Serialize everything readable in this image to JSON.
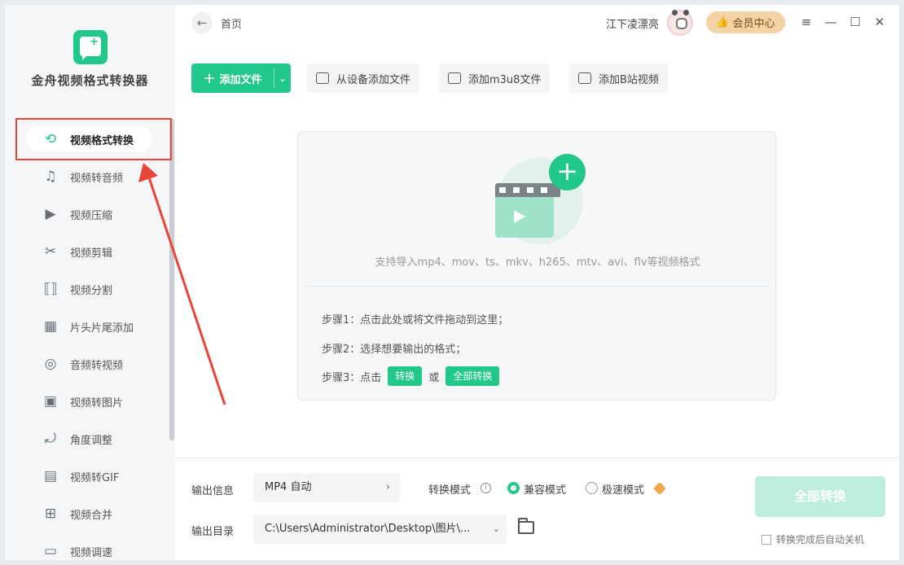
{
  "app": {
    "title": "金舟视频格式转换器"
  },
  "sidebar": {
    "items": [
      {
        "label": "视频格式转换",
        "icon": "convert-icon",
        "active": true
      },
      {
        "label": "视频转音频",
        "icon": "music-note-icon"
      },
      {
        "label": "视频压缩",
        "icon": "compress-icon"
      },
      {
        "label": "视频剪辑",
        "icon": "scissors-icon"
      },
      {
        "label": "视频分割",
        "icon": "split-icon"
      },
      {
        "label": "片头片尾添加",
        "icon": "film-icon"
      },
      {
        "label": "音频转视频",
        "icon": "disc-icon"
      },
      {
        "label": "视频转图片",
        "icon": "image-icon"
      },
      {
        "label": "角度调整",
        "icon": "rotate-icon"
      },
      {
        "label": "视频转GIF",
        "icon": "gif-icon"
      },
      {
        "label": "视频合并",
        "icon": "merge-icon"
      },
      {
        "label": "视频调速",
        "icon": "speed-icon"
      }
    ]
  },
  "header": {
    "breadcrumb": "首页",
    "username": "江下凌漂亮",
    "vip_label": "会员中心"
  },
  "toolbar": {
    "add_file": "添加文件",
    "add_from_device": "从设备添加文件",
    "add_m3u8": "添加m3u8文件",
    "add_bilibili": "添加B站视频"
  },
  "drop_area": {
    "supported_formats": "支持导入mp4、mov、ts、mkv、h265、mtv、avi、flv等视频格式",
    "step1": "步骤1：点击此处或将文件拖动到这里；",
    "step2": "步骤2：选择想要输出的格式；",
    "step3_prefix": "步骤3：点击",
    "step3_tag1": "转换",
    "step3_or": "或",
    "step3_tag2": "全部转换"
  },
  "bottom": {
    "output_info_label": "输出信息",
    "output_format": "MP4 自动",
    "output_dir_label": "输出目录",
    "output_dir": "C:\\Users\\Administrator\\Desktop\\图片\\...",
    "mode_label": "转换模式",
    "mode_compatible": "兼容模式",
    "mode_fast": "极速模式",
    "selected_mode": "兼容模式",
    "convert_all": "全部转换",
    "auto_shutdown": "转换完成后自动关机"
  },
  "colors": {
    "accent": "#22c78a",
    "annotation_red": "#e8463a",
    "vip_bg": "#f3d3a6"
  }
}
